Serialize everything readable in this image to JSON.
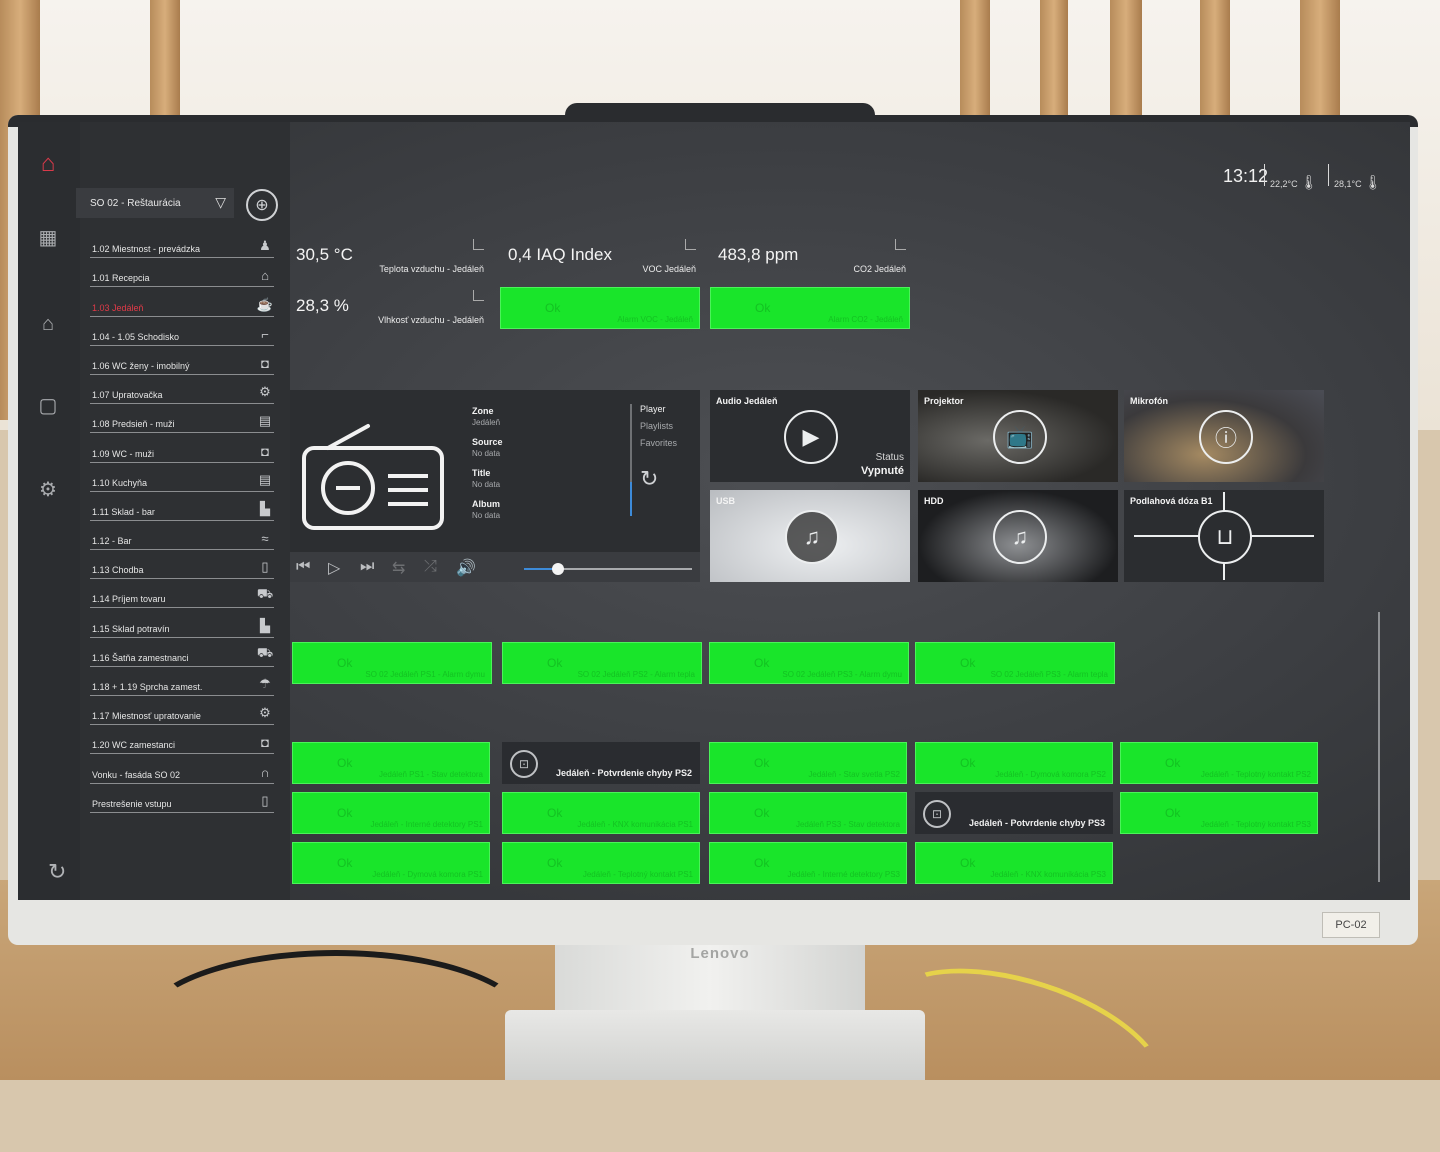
{
  "header": {
    "time": "13:12",
    "temp_inside": "22,2°C",
    "temp_outside": "28,1°C"
  },
  "zone_select": {
    "value": "SO 02 - Reštaurácia"
  },
  "rooms": [
    {
      "label": "1.02 Miestnost - prevádzka",
      "icon": "people-icon",
      "glyph": "♟",
      "active": false
    },
    {
      "label": "1.01 Recepcia",
      "icon": "bell-icon",
      "glyph": "⌂",
      "active": false
    },
    {
      "label": "1.03 Jedáleň",
      "icon": "dining-icon",
      "glyph": "☕",
      "active": true
    },
    {
      "label": "1.04 - 1.05 Schodisko",
      "icon": "stairs-icon",
      "glyph": "⌐",
      "active": false
    },
    {
      "label": "1.06 WC ženy - imobilný",
      "icon": "wc-icon",
      "glyph": "◘",
      "active": false
    },
    {
      "label": "1.07 Upratovačka",
      "icon": "cleaning-icon",
      "glyph": "⚙",
      "active": false
    },
    {
      "label": "1.08 Predsieň - muži",
      "icon": "shelf-icon",
      "glyph": "▤",
      "active": false
    },
    {
      "label": "1.09 WC - muži",
      "icon": "wc-icon",
      "glyph": "◘",
      "active": false
    },
    {
      "label": "1.10 Kuchyňa",
      "icon": "kitchen-icon",
      "glyph": "▤",
      "active": false
    },
    {
      "label": "1.11 Sklad - bar",
      "icon": "storage-icon",
      "glyph": "▙",
      "active": false
    },
    {
      "label": "1.12 - Bar",
      "icon": "bar-icon",
      "glyph": "≈",
      "active": false
    },
    {
      "label": "1.13 Chodba",
      "icon": "door-icon",
      "glyph": "▯",
      "active": false
    },
    {
      "label": "1.14 Príjem tovaru",
      "icon": "truck-icon",
      "glyph": "⛟",
      "active": false
    },
    {
      "label": "1.15 Sklad potravín",
      "icon": "storage-icon",
      "glyph": "▙",
      "active": false
    },
    {
      "label": "1.16 Šatňa zamestnanci",
      "icon": "wardrobe-icon",
      "glyph": "⛟",
      "active": false
    },
    {
      "label": "1.18 + 1.19 Sprcha zamest.",
      "icon": "shower-icon",
      "glyph": "☂",
      "active": false
    },
    {
      "label": "1.17 Miestnosť upratovanie",
      "icon": "cleaning-icon",
      "glyph": "⚙",
      "active": false
    },
    {
      "label": "1.20 WC zamestanci",
      "icon": "wc-icon",
      "glyph": "◘",
      "active": false
    },
    {
      "label": "Vonku - fasáda SO 02",
      "icon": "facade-icon",
      "glyph": "∩",
      "active": false
    },
    {
      "label": "Prestrešenie vstupu",
      "icon": "entrance-icon",
      "glyph": "▯",
      "active": false
    }
  ],
  "sensors": {
    "temp": {
      "value": "30,5 °C",
      "name": "Teplota vzduchu - Jedáleň"
    },
    "voc": {
      "value": "0,4 IAQ Index",
      "name": "VOC Jedáleň"
    },
    "co2": {
      "value": "483,8 ppm",
      "name": "CO2 Jedáleň"
    },
    "humidity": {
      "value": "28,3 %",
      "name": "Vlhkosť vzduchu - Jedáleň"
    }
  },
  "alarms_top": [
    {
      "state": "Ok",
      "name": "Alarm VOC - Jedáleň"
    },
    {
      "state": "Ok",
      "name": "Alarm CO2 - Jedáleň"
    }
  ],
  "player": {
    "zone_k": "Zone",
    "zone_v": "Jedáleň",
    "source_k": "Source",
    "source_v": "No data",
    "title_k": "Title",
    "title_v": "No data",
    "album_k": "Album",
    "album_v": "No data",
    "menu": [
      "Player",
      "Playlists",
      "Favorites"
    ],
    "volume": 0.2
  },
  "media_cards": {
    "audio": {
      "label": "Audio Jedáleň",
      "status_k": "Status",
      "status_v": "Vypnuté"
    },
    "projector": {
      "label": "Projektor"
    },
    "mic": {
      "label": "Mikrofón"
    },
    "usb": {
      "label": "USB"
    },
    "hdd": {
      "label": "HDD"
    },
    "floor": {
      "label": "Podlahová dóza B1"
    }
  },
  "alarms_mid": [
    {
      "state": "Ok",
      "name": "SO 02 Jedáleň PS1 - Alarm dymu"
    },
    {
      "state": "Ok",
      "name": "SO 02 Jedáleň PS2 - Alarm tepla"
    },
    {
      "state": "Ok",
      "name": "SO 02 Jedáleň PS3 - Alarm dymu"
    },
    {
      "state": "Ok",
      "name": "SO 02 Jedáleň PS3 - Alarm tepla"
    }
  ],
  "alarms_bottom": [
    {
      "state": "Ok",
      "name": "Jedáleň PS1 - Stav detektora"
    },
    {
      "state": "",
      "name": "Jedáleň - Potvrdenie chyby PS2",
      "dark": true
    },
    {
      "state": "Ok",
      "name": "Jedáleň - Stav svetla PS2"
    },
    {
      "state": "Ok",
      "name": "Jedáleň - Dymová komora PS2"
    },
    {
      "state": "Ok",
      "name": "Jedáleň - Teplotný kontakt PS2"
    },
    {
      "state": "Ok",
      "name": "Jedáleň - Interné detektory PS1"
    },
    {
      "state": "Ok",
      "name": "Jedáleň - KNX komunikácia PS1"
    },
    {
      "state": "Ok",
      "name": "Jedáleň PS3 - Stav detektora"
    },
    {
      "state": "",
      "name": "Jedáleň - Potvrdenie chyby PS3",
      "dark": true
    },
    {
      "state": "Ok",
      "name": "Jedáleň - Teplotný kontakt PS3"
    },
    {
      "state": "Ok",
      "name": "Jedáleň - Dymová komora PS1"
    },
    {
      "state": "Ok",
      "name": "Jedáleň - Teplotný kontakt PS1"
    },
    {
      "state": "Ok",
      "name": "Jedáleň - Interné detektory PS3"
    },
    {
      "state": "Ok",
      "name": "Jedáleň - KNX komunikácia PS3"
    }
  ],
  "monitor": {
    "brand": "Lenovo",
    "label": "PC-02"
  },
  "colors": {
    "accent": "#d93a4a",
    "ok": "#19e52a",
    "panel": "#2c2e31"
  }
}
